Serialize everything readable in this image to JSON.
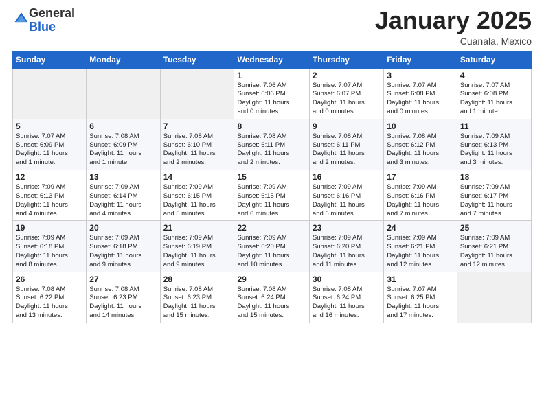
{
  "header": {
    "logo_general": "General",
    "logo_blue": "Blue",
    "month_title": "January 2025",
    "location": "Cuanala, Mexico"
  },
  "weekdays": [
    "Sunday",
    "Monday",
    "Tuesday",
    "Wednesday",
    "Thursday",
    "Friday",
    "Saturday"
  ],
  "weeks": [
    [
      {
        "day": "",
        "text": ""
      },
      {
        "day": "",
        "text": ""
      },
      {
        "day": "",
        "text": ""
      },
      {
        "day": "1",
        "text": "Sunrise: 7:06 AM\nSunset: 6:06 PM\nDaylight: 11 hours\nand 0 minutes."
      },
      {
        "day": "2",
        "text": "Sunrise: 7:07 AM\nSunset: 6:07 PM\nDaylight: 11 hours\nand 0 minutes."
      },
      {
        "day": "3",
        "text": "Sunrise: 7:07 AM\nSunset: 6:08 PM\nDaylight: 11 hours\nand 0 minutes."
      },
      {
        "day": "4",
        "text": "Sunrise: 7:07 AM\nSunset: 6:08 PM\nDaylight: 11 hours\nand 1 minute."
      }
    ],
    [
      {
        "day": "5",
        "text": "Sunrise: 7:07 AM\nSunset: 6:09 PM\nDaylight: 11 hours\nand 1 minute."
      },
      {
        "day": "6",
        "text": "Sunrise: 7:08 AM\nSunset: 6:09 PM\nDaylight: 11 hours\nand 1 minute."
      },
      {
        "day": "7",
        "text": "Sunrise: 7:08 AM\nSunset: 6:10 PM\nDaylight: 11 hours\nand 2 minutes."
      },
      {
        "day": "8",
        "text": "Sunrise: 7:08 AM\nSunset: 6:11 PM\nDaylight: 11 hours\nand 2 minutes."
      },
      {
        "day": "9",
        "text": "Sunrise: 7:08 AM\nSunset: 6:11 PM\nDaylight: 11 hours\nand 2 minutes."
      },
      {
        "day": "10",
        "text": "Sunrise: 7:08 AM\nSunset: 6:12 PM\nDaylight: 11 hours\nand 3 minutes."
      },
      {
        "day": "11",
        "text": "Sunrise: 7:09 AM\nSunset: 6:13 PM\nDaylight: 11 hours\nand 3 minutes."
      }
    ],
    [
      {
        "day": "12",
        "text": "Sunrise: 7:09 AM\nSunset: 6:13 PM\nDaylight: 11 hours\nand 4 minutes."
      },
      {
        "day": "13",
        "text": "Sunrise: 7:09 AM\nSunset: 6:14 PM\nDaylight: 11 hours\nand 4 minutes."
      },
      {
        "day": "14",
        "text": "Sunrise: 7:09 AM\nSunset: 6:15 PM\nDaylight: 11 hours\nand 5 minutes."
      },
      {
        "day": "15",
        "text": "Sunrise: 7:09 AM\nSunset: 6:15 PM\nDaylight: 11 hours\nand 6 minutes."
      },
      {
        "day": "16",
        "text": "Sunrise: 7:09 AM\nSunset: 6:16 PM\nDaylight: 11 hours\nand 6 minutes."
      },
      {
        "day": "17",
        "text": "Sunrise: 7:09 AM\nSunset: 6:16 PM\nDaylight: 11 hours\nand 7 minutes."
      },
      {
        "day": "18",
        "text": "Sunrise: 7:09 AM\nSunset: 6:17 PM\nDaylight: 11 hours\nand 7 minutes."
      }
    ],
    [
      {
        "day": "19",
        "text": "Sunrise: 7:09 AM\nSunset: 6:18 PM\nDaylight: 11 hours\nand 8 minutes."
      },
      {
        "day": "20",
        "text": "Sunrise: 7:09 AM\nSunset: 6:18 PM\nDaylight: 11 hours\nand 9 minutes."
      },
      {
        "day": "21",
        "text": "Sunrise: 7:09 AM\nSunset: 6:19 PM\nDaylight: 11 hours\nand 9 minutes."
      },
      {
        "day": "22",
        "text": "Sunrise: 7:09 AM\nSunset: 6:20 PM\nDaylight: 11 hours\nand 10 minutes."
      },
      {
        "day": "23",
        "text": "Sunrise: 7:09 AM\nSunset: 6:20 PM\nDaylight: 11 hours\nand 11 minutes."
      },
      {
        "day": "24",
        "text": "Sunrise: 7:09 AM\nSunset: 6:21 PM\nDaylight: 11 hours\nand 12 minutes."
      },
      {
        "day": "25",
        "text": "Sunrise: 7:09 AM\nSunset: 6:21 PM\nDaylight: 11 hours\nand 12 minutes."
      }
    ],
    [
      {
        "day": "26",
        "text": "Sunrise: 7:08 AM\nSunset: 6:22 PM\nDaylight: 11 hours\nand 13 minutes."
      },
      {
        "day": "27",
        "text": "Sunrise: 7:08 AM\nSunset: 6:23 PM\nDaylight: 11 hours\nand 14 minutes."
      },
      {
        "day": "28",
        "text": "Sunrise: 7:08 AM\nSunset: 6:23 PM\nDaylight: 11 hours\nand 15 minutes."
      },
      {
        "day": "29",
        "text": "Sunrise: 7:08 AM\nSunset: 6:24 PM\nDaylight: 11 hours\nand 15 minutes."
      },
      {
        "day": "30",
        "text": "Sunrise: 7:08 AM\nSunset: 6:24 PM\nDaylight: 11 hours\nand 16 minutes."
      },
      {
        "day": "31",
        "text": "Sunrise: 7:07 AM\nSunset: 6:25 PM\nDaylight: 11 hours\nand 17 minutes."
      },
      {
        "day": "",
        "text": ""
      }
    ]
  ]
}
